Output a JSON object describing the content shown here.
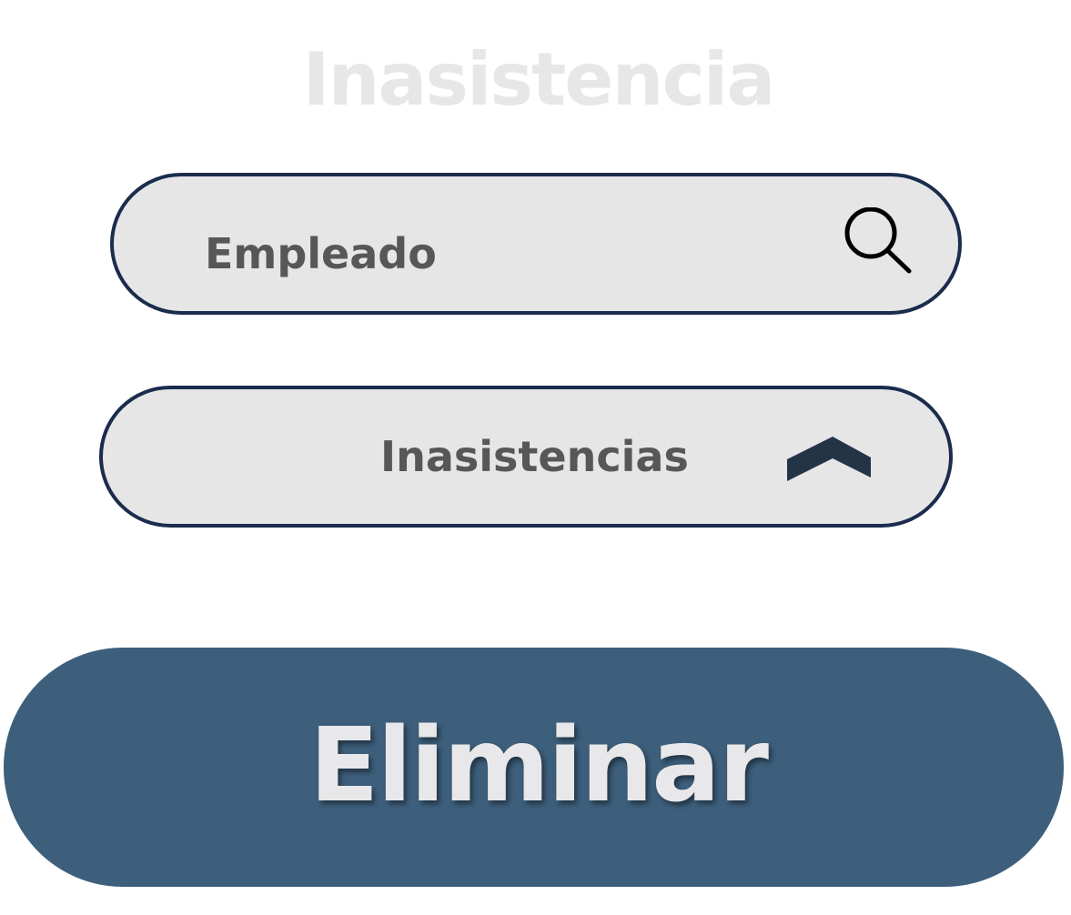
{
  "page": {
    "title": "Inasistencia"
  },
  "search": {
    "label": "Empleado",
    "icon": "search-icon"
  },
  "dropdown": {
    "selected": "Inasistencias",
    "icon": "chevron-up-icon"
  },
  "actions": {
    "delete_label": "Eliminar"
  },
  "colors": {
    "title_text": "#e7e7e8",
    "field_background": "#e6e6e7",
    "field_border": "#1b2c4d",
    "field_text": "#575757",
    "chevron": "#233447",
    "button_background": "#3d5f7c",
    "button_text": "#e8e8ea"
  }
}
